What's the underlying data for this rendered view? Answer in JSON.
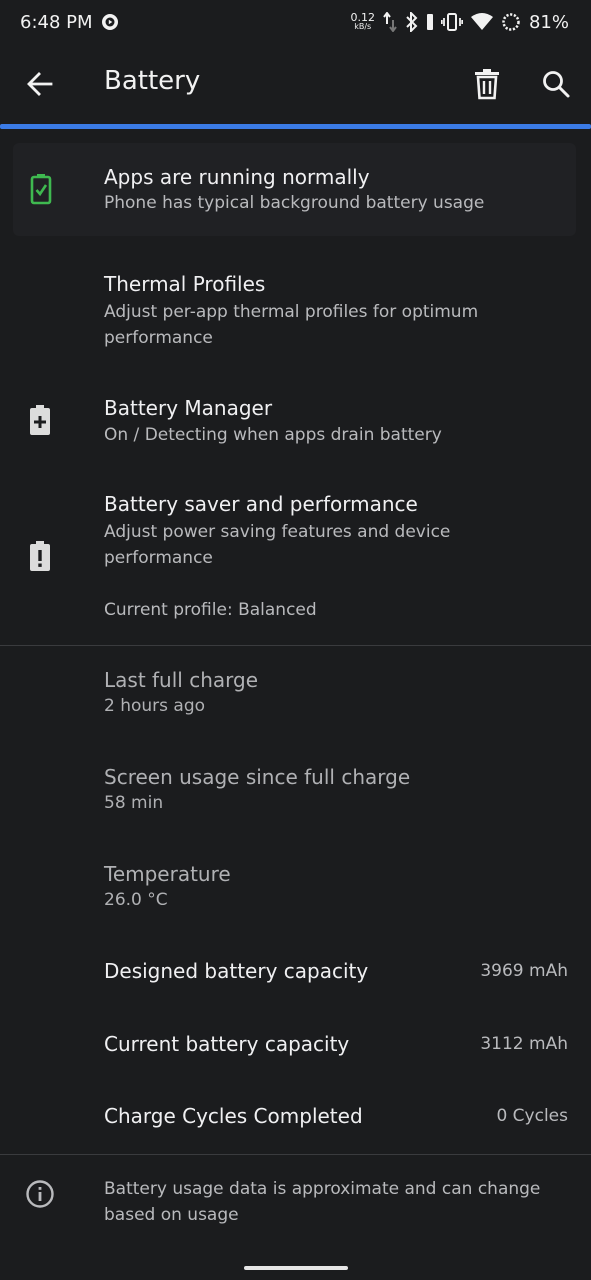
{
  "status_bar": {
    "time": "6:48 PM",
    "net_speed_value": "0.12",
    "net_speed_unit": "kB/s",
    "battery_percent": "81%",
    "icons": [
      "media-icon",
      "data-arrows-icon",
      "bluetooth-icon",
      "vibrate-icon",
      "wifi-icon",
      "battery-ring-icon"
    ]
  },
  "app_bar": {
    "title": "Battery",
    "back_icon": "back-arrow-icon",
    "delete_icon": "trash-icon",
    "search_icon": "search-icon"
  },
  "colors": {
    "accent": "#3b7be6",
    "ok_green": "#3fb950",
    "background": "#1b1c1e",
    "card": "#202124"
  },
  "status_card": {
    "title": "Apps are running normally",
    "subtitle": "Phone has typical background battery usage",
    "icon": "battery-ok-icon"
  },
  "settings": [
    {
      "title": "Thermal Profiles",
      "subtitle": "Adjust per-app thermal profiles for optimum performance"
    },
    {
      "title": "Battery Manager",
      "subtitle": "On / Detecting when apps drain battery",
      "icon": "battery-plus-icon"
    },
    {
      "title": "Battery saver and performance",
      "subtitle": "Adjust power saving features and device performance",
      "extra": "Current profile: Balanced",
      "icon": "battery-alert-icon"
    }
  ],
  "stats": [
    {
      "title": "Last full charge",
      "value": "2 hours ago"
    },
    {
      "title": "Screen usage since full charge",
      "value": "58 min"
    },
    {
      "title": "Temperature",
      "value": "26.0 °C"
    }
  ],
  "capacity": [
    {
      "label": "Designed battery capacity",
      "value": "3969 mAh"
    },
    {
      "label": "Current battery capacity",
      "value": "3112 mAh"
    },
    {
      "label": "Charge Cycles Completed",
      "value": "0 Cycles"
    }
  ],
  "footer": {
    "text": "Battery usage data is approximate and can change based on usage",
    "icon": "info-icon"
  }
}
